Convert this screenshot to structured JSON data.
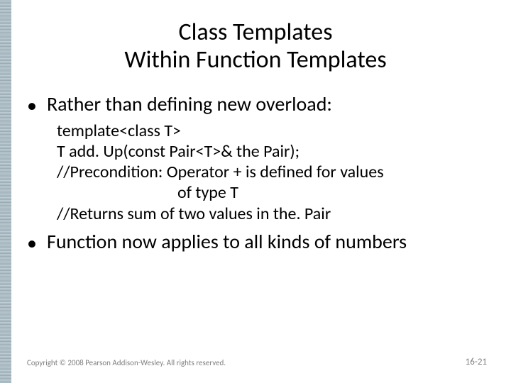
{
  "title": {
    "line1": "Class Templates",
    "line2": "Within Function Templates"
  },
  "bullets": {
    "b1": "Rather than defining new overload:",
    "b2": "Function now applies to all kinds of numbers"
  },
  "code": {
    "l1": "template<class T>",
    "l2": "T add. Up(const Pair<T>& the Pair);",
    "l3": "//Precondition: Operator + is defined for values",
    "l4": "of type T",
    "l5": "//Returns sum of two values in the. Pair"
  },
  "footer": {
    "copyright": "Copyright © 2008 Pearson Addison-Wesley. All rights reserved.",
    "page": "16-21"
  }
}
